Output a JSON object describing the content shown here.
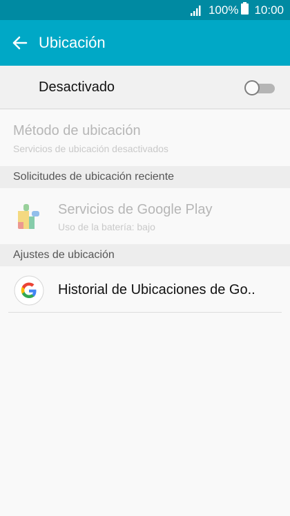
{
  "status_bar": {
    "battery_percent": "100%",
    "time": "10:00"
  },
  "app_bar": {
    "title": "Ubicación"
  },
  "master_switch": {
    "label": "Desactivado",
    "state": "off"
  },
  "location_method": {
    "title": "Método de ubicación",
    "subtitle": "Servicios de ubicación desactivados"
  },
  "recent_requests": {
    "header": "Solicitudes de ubicación reciente",
    "items": [
      {
        "title": "Servicios de Google Play",
        "subtitle": "Uso de la batería: bajo",
        "icon": "google-play-services-icon"
      }
    ]
  },
  "settings": {
    "header": "Ajustes de ubicación",
    "items": [
      {
        "title": "Historial de Ubicaciones de Go..",
        "icon": "google-g-icon"
      }
    ]
  },
  "colors": {
    "status_bar": "#008aa2",
    "app_bar": "#00a8c6",
    "background": "#f9f9f9"
  }
}
